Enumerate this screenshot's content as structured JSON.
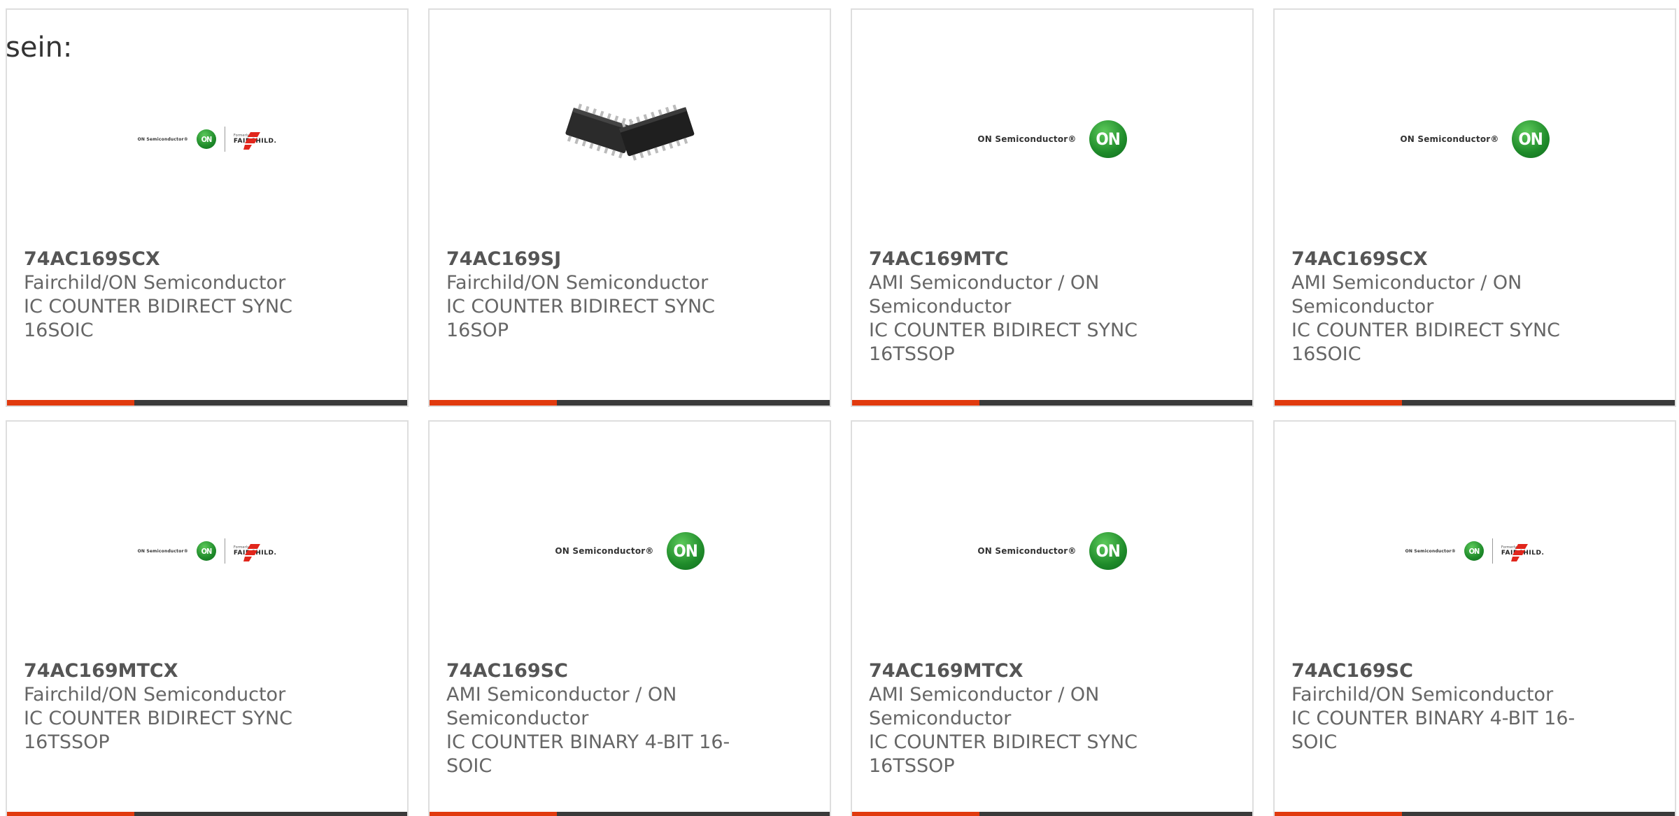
{
  "intro_text": "sein:",
  "logos": {
    "on_semi_text": "ON Semiconductor®",
    "on_mark": "ON",
    "fairchild_formerly": "Formerly",
    "fairchild_name": "FAIRCHILD."
  },
  "cards": [
    {
      "part": "74AC169SCX",
      "maker": "Fairchild/ON Semiconductor",
      "desc": "IC COUNTER BIDIRECT SYNC 16SOIC",
      "image": "on-fairchild-logo"
    },
    {
      "part": "74AC169SJ",
      "maker": "Fairchild/ON Semiconductor",
      "desc": "IC COUNTER BIDIRECT SYNC 16SOP",
      "image": "chip-photo"
    },
    {
      "part": "74AC169MTC",
      "maker": "AMI Semiconductor / ON Semiconductor",
      "desc": "IC COUNTER BIDIRECT SYNC 16TSSOP",
      "image": "on-semi-logo"
    },
    {
      "part": "74AC169SCX",
      "maker": "AMI Semiconductor / ON Semiconductor",
      "desc": "IC COUNTER BIDIRECT SYNC 16SOIC",
      "image": "on-semi-logo"
    },
    {
      "part": "74AC169MTCX",
      "maker": "Fairchild/ON Semiconductor",
      "desc": "IC COUNTER BIDIRECT SYNC 16TSSOP",
      "image": "on-fairchild-logo"
    },
    {
      "part": "74AC169SC",
      "maker": "AMI Semiconductor / ON Semiconductor",
      "desc": "IC COUNTER BINARY 4-BIT 16-SOIC",
      "image": "on-semi-logo"
    },
    {
      "part": "74AC169MTCX",
      "maker": "AMI Semiconductor / ON Semiconductor",
      "desc": "IC COUNTER BIDIRECT SYNC 16TSSOP",
      "image": "on-semi-logo"
    },
    {
      "part": "74AC169SC",
      "maker": "Fairchild/ON Semiconductor",
      "desc": "IC COUNTER BINARY 4-BIT 16-SOIC",
      "image": "on-fairchild-logo"
    }
  ],
  "colors": {
    "accent": "#e13a0e",
    "bar_dark": "#3a3a3a",
    "on_green": "#1f8b2a",
    "text": "#666666"
  }
}
